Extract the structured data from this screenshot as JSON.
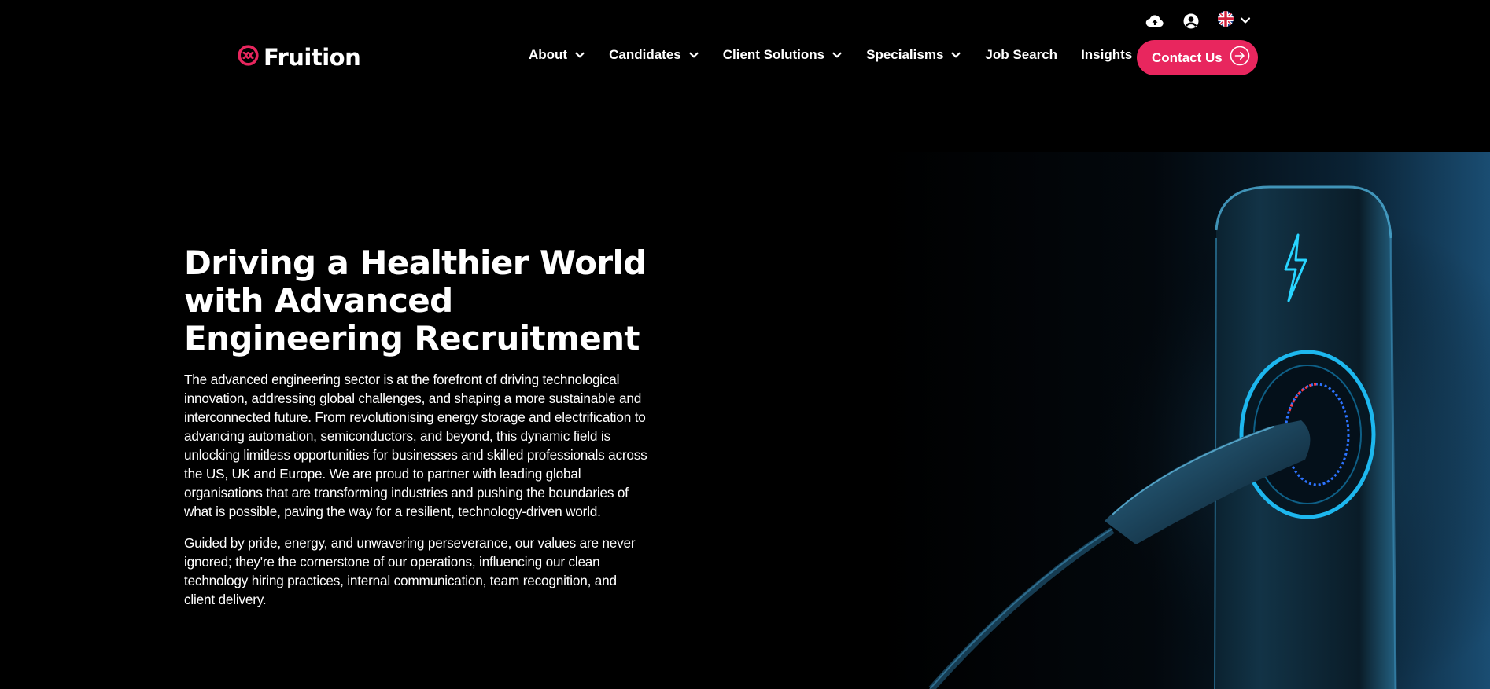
{
  "brand": {
    "name": "Fruition",
    "accent": "#e8265e",
    "background": "#000000"
  },
  "utility": {
    "icons": [
      "cloud-upload-icon",
      "user-account-icon",
      "uk-flag-icon",
      "chevron-down-icon"
    ]
  },
  "nav": {
    "items": [
      {
        "label": "About",
        "dropdown": true
      },
      {
        "label": "Candidates",
        "dropdown": true
      },
      {
        "label": "Client Solutions",
        "dropdown": true
      },
      {
        "label": "Specialisms",
        "dropdown": true
      },
      {
        "label": "Job Search",
        "dropdown": false
      },
      {
        "label": "Insights",
        "dropdown": true
      }
    ],
    "cta": {
      "label": "Contact Us",
      "icon": "arrow-right-circle-icon"
    }
  },
  "hero": {
    "title": "Driving a Healthier World with Advanced Engineering Recruitment",
    "paragraphs": [
      "The advanced engineering sector is at the forefront of driving technological innovation, addressing global challenges, and shaping a more sustainable and interconnected future. From revolutionising energy storage and electrification to advancing automation, semiconductors, and beyond, this dynamic field is unlocking limitless opportunities for businesses and skilled professionals across the US, UK and Europe. We are proud to partner with leading global organisations that are transforming industries and pushing the boundaries of what is possible, paving the way for a resilient, technology-driven world.",
      "Guided by pride, energy, and unwavering perseverance, our values are never ignored; they're the cornerstone of our operations, influencing our clean technology hiring practices, internal communication, team recognition, and client delivery."
    ]
  }
}
